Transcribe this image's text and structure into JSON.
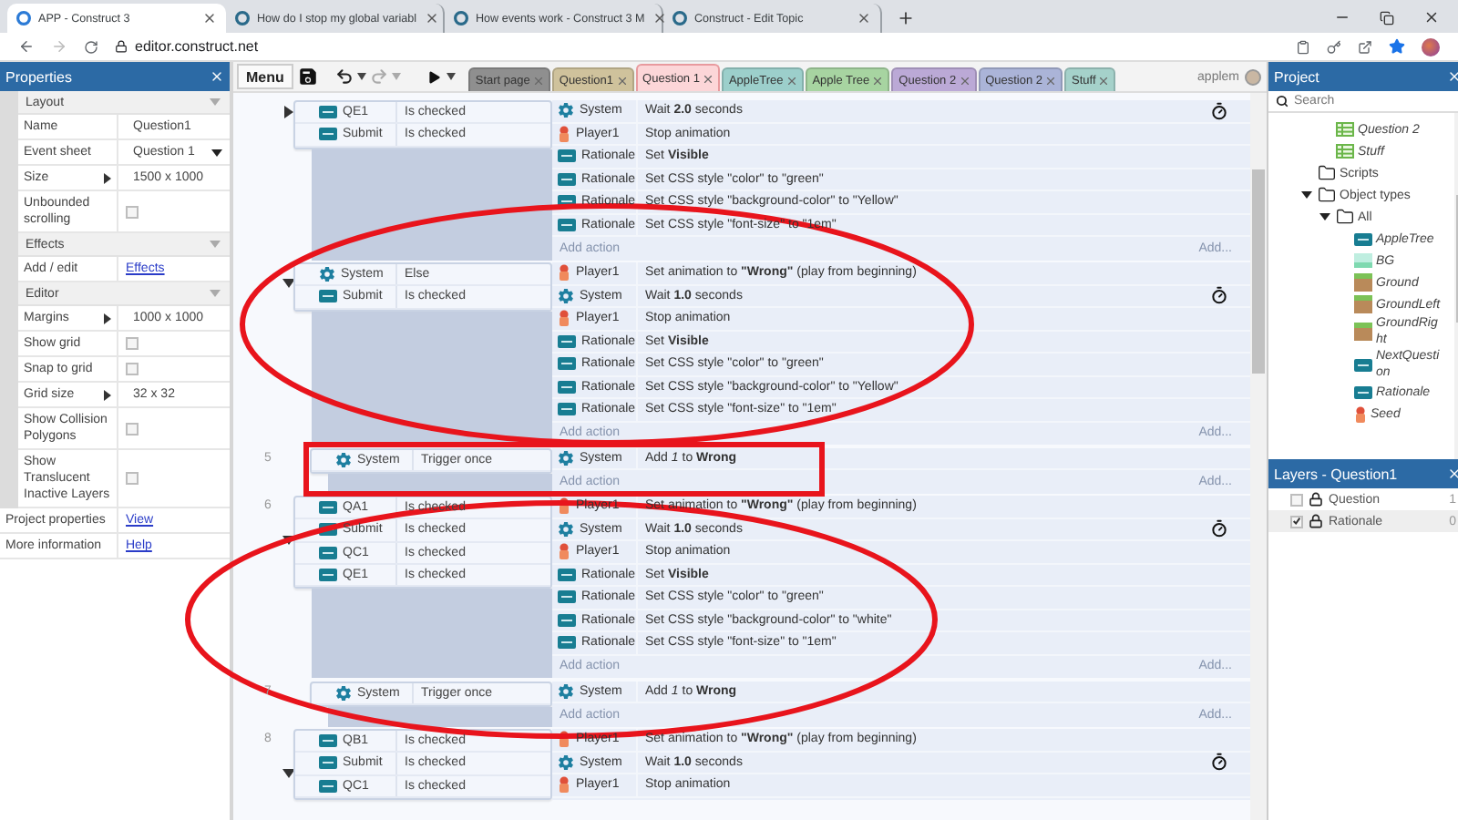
{
  "browser": {
    "tabs": [
      {
        "title": "APP - Construct 3",
        "selected": true
      },
      {
        "title": "How do I stop my global variabl",
        "selected": false
      },
      {
        "title": "How events work - Construct 3 M",
        "selected": false
      },
      {
        "title": "Construct - Edit Topic",
        "selected": false
      }
    ],
    "url": "editor.construct.net"
  },
  "properties": {
    "title": "Properties",
    "sections": [
      {
        "title": "Layout",
        "expanded": true,
        "rows": [
          {
            "label": "Name",
            "kind": "text",
            "value": "Question1"
          },
          {
            "label": "Event sheet",
            "kind": "dropdown",
            "value": "Question 1"
          },
          {
            "label": "Size",
            "kind": "expand",
            "value": "1500 x 1000"
          },
          {
            "label": "Unbounded scrolling",
            "kind": "checkbox",
            "checked": false
          }
        ]
      },
      {
        "title": "Effects",
        "expanded": true,
        "rows": [
          {
            "label": "Add / edit",
            "kind": "link",
            "value": "Effects"
          }
        ]
      },
      {
        "title": "Editor",
        "expanded": true,
        "rows": [
          {
            "label": "Margins",
            "kind": "expand",
            "value": "1000 x 1000"
          },
          {
            "label": "Show grid",
            "kind": "checkbox",
            "checked": false
          },
          {
            "label": "Snap to grid",
            "kind": "checkbox",
            "checked": false
          },
          {
            "label": "Grid size",
            "kind": "expand",
            "value": "32 x 32"
          },
          {
            "label": "Show Collision Polygons",
            "kind": "checkbox",
            "checked": false
          },
          {
            "label": "Show Translucent Inactive Layers",
            "kind": "checkbox",
            "checked": false
          }
        ]
      }
    ],
    "footer": [
      {
        "label": "Project properties",
        "kind": "link",
        "value": "View"
      },
      {
        "label": "More information",
        "kind": "link",
        "value": "Help"
      }
    ]
  },
  "toolbar": {
    "menu": "Menu",
    "user": "applem",
    "tabs": [
      {
        "label": "Start page",
        "color": "#8f8f8f",
        "selected": false
      },
      {
        "label": "Question1",
        "color": "#cfc29c",
        "selected": false
      },
      {
        "label": "Question 1",
        "color": "#fcd6d8",
        "selected": true
      },
      {
        "label": "AppleTree",
        "color": "#9ccfcb",
        "selected": false
      },
      {
        "label": "Apple Tree",
        "color": "#a7d4a1",
        "selected": false
      },
      {
        "label": "Question 2",
        "color": "#bba9d6",
        "selected": false
      },
      {
        "label": "Question 2",
        "color": "#abb4d8",
        "selected": false
      },
      {
        "label": "Stuff",
        "color": "#a5d1ca",
        "selected": false
      }
    ]
  },
  "events": [
    {
      "expanded": false,
      "conditions": [
        {
          "object": "QE1",
          "kind": "text",
          "condition": "Is checked"
        },
        {
          "object": "Submit",
          "kind": "text",
          "condition": "Is checked"
        }
      ],
      "actions": [
        {
          "object": "System",
          "kind": "system",
          "action": "Wait **2.0** seconds",
          "timer": true
        },
        {
          "object": "Player1",
          "kind": "sprite",
          "action": "Stop animation"
        },
        {
          "object": "Rationale",
          "kind": "text",
          "action": "Set **Visible**"
        },
        {
          "object": "Rationale",
          "kind": "text",
          "action": "Set CSS style \"color\" to \"green\""
        },
        {
          "object": "Rationale",
          "kind": "text",
          "action": "Set CSS style \"background-color\" to \"Yellow\""
        },
        {
          "object": "Rationale",
          "kind": "text",
          "action": "Set CSS style \"font-size\" to \"1em\""
        }
      ],
      "add_action": "Add action",
      "add": "Add..."
    },
    {
      "expanded": true,
      "conditions": [
        {
          "object": "System",
          "kind": "system",
          "condition": "Else"
        },
        {
          "object": "Submit",
          "kind": "text",
          "condition": "Is checked"
        }
      ],
      "actions": [
        {
          "object": "Player1",
          "kind": "sprite",
          "action": "Set animation to **\"Wrong\"** (play from beginning)"
        },
        {
          "object": "System",
          "kind": "system",
          "action": "Wait **1.0** seconds",
          "timer": true
        },
        {
          "object": "Player1",
          "kind": "sprite",
          "action": "Stop animation"
        },
        {
          "object": "Rationale",
          "kind": "text",
          "action": "Set **Visible**"
        },
        {
          "object": "Rationale",
          "kind": "text",
          "action": "Set CSS style \"color\" to \"green\""
        },
        {
          "object": "Rationale",
          "kind": "text",
          "action": "Set CSS style \"background-color\" to \"Yellow\""
        },
        {
          "object": "Rationale",
          "kind": "text",
          "action": "Set CSS style \"font-size\" to \"1em\""
        }
      ],
      "add_action": "Add action",
      "add": "Add...",
      "children": [
        {
          "number": "5",
          "conditions": [
            {
              "object": "System",
              "kind": "system",
              "condition": "Trigger once"
            }
          ],
          "actions": [
            {
              "object": "System",
              "kind": "system",
              "action": "Add *1* to **Wrong**"
            }
          ],
          "add_action": "Add action",
          "add": "Add..."
        }
      ]
    },
    {
      "number": "6",
      "expanded": true,
      "conditions": [
        {
          "object": "QA1",
          "kind": "text",
          "condition": "Is checked"
        },
        {
          "object": "Submit",
          "kind": "text",
          "condition": "Is checked"
        },
        {
          "object": "QC1",
          "kind": "text",
          "condition": "Is checked"
        },
        {
          "object": "QE1",
          "kind": "text",
          "condition": "Is checked"
        }
      ],
      "actions": [
        {
          "object": "Player1",
          "kind": "sprite",
          "action": "Set animation to **\"Wrong\"** (play from beginning)"
        },
        {
          "object": "System",
          "kind": "system",
          "action": "Wait **1.0** seconds",
          "timer": true
        },
        {
          "object": "Player1",
          "kind": "sprite",
          "action": "Stop animation"
        },
        {
          "object": "Rationale",
          "kind": "text",
          "action": "Set **Visible**"
        },
        {
          "object": "Rationale",
          "kind": "text",
          "action": "Set CSS style \"color\" to \"green\""
        },
        {
          "object": "Rationale",
          "kind": "text",
          "action": "Set CSS style \"background-color\" to \"white\""
        },
        {
          "object": "Rationale",
          "kind": "text",
          "action": "Set CSS style \"font-size\" to \"1em\""
        }
      ],
      "add_action": "Add action",
      "add": "Add...",
      "children": [
        {
          "number": "7",
          "conditions": [
            {
              "object": "System",
              "kind": "system",
              "condition": "Trigger once"
            }
          ],
          "actions": [
            {
              "object": "System",
              "kind": "system",
              "action": "Add *1* to **Wrong**"
            }
          ],
          "add_action": "Add action",
          "add": "Add..."
        }
      ]
    },
    {
      "number": "8",
      "expanded": true,
      "conditions": [
        {
          "object": "QB1",
          "kind": "text",
          "condition": "Is checked"
        },
        {
          "object": "Submit",
          "kind": "text",
          "condition": "Is checked"
        },
        {
          "object": "QC1",
          "kind": "text",
          "condition": "Is checked"
        }
      ],
      "actions": [
        {
          "object": "Player1",
          "kind": "sprite",
          "action": "Set animation to **\"Wrong\"** (play from beginning)"
        },
        {
          "object": "System",
          "kind": "system",
          "action": "Wait **1.0** seconds",
          "timer": true
        },
        {
          "object": "Player1",
          "kind": "sprite",
          "action": "Stop animation"
        }
      ]
    }
  ],
  "annotations": [
    {
      "kind": "ellipse"
    },
    {
      "kind": "rectangle"
    },
    {
      "kind": "ellipse"
    }
  ],
  "project": {
    "title": "Project",
    "placeholder": "Search",
    "tree": [
      {
        "label": "Question 2",
        "kind": "sheet"
      },
      {
        "label": "Stuff",
        "kind": "sheet"
      },
      {
        "label": "Scripts",
        "kind": "folder"
      },
      {
        "label": "Object types",
        "kind": "folder",
        "expanded": true,
        "children": [
          {
            "label": "All",
            "kind": "folder",
            "expanded": true,
            "children": [
              {
                "label": "AppleTree",
                "kind": "text"
              },
              {
                "label": "BG",
                "kind": "background"
              },
              {
                "label": "Ground",
                "kind": "tile"
              },
              {
                "label": "GroundLeft",
                "kind": "tile"
              },
              {
                "label": "GroundRight",
                "kind": "tile"
              },
              {
                "label": "NextQuestion",
                "kind": "text"
              },
              {
                "label": "Rationale",
                "kind": "text"
              },
              {
                "label": "Seed",
                "kind": "sprite"
              }
            ]
          }
        ]
      }
    ]
  },
  "layers": {
    "title": "Layers - Question1",
    "rows": [
      {
        "name": "Question",
        "visible": false,
        "count": "1"
      },
      {
        "name": "Rationale",
        "visible": true,
        "count": "0"
      }
    ]
  }
}
